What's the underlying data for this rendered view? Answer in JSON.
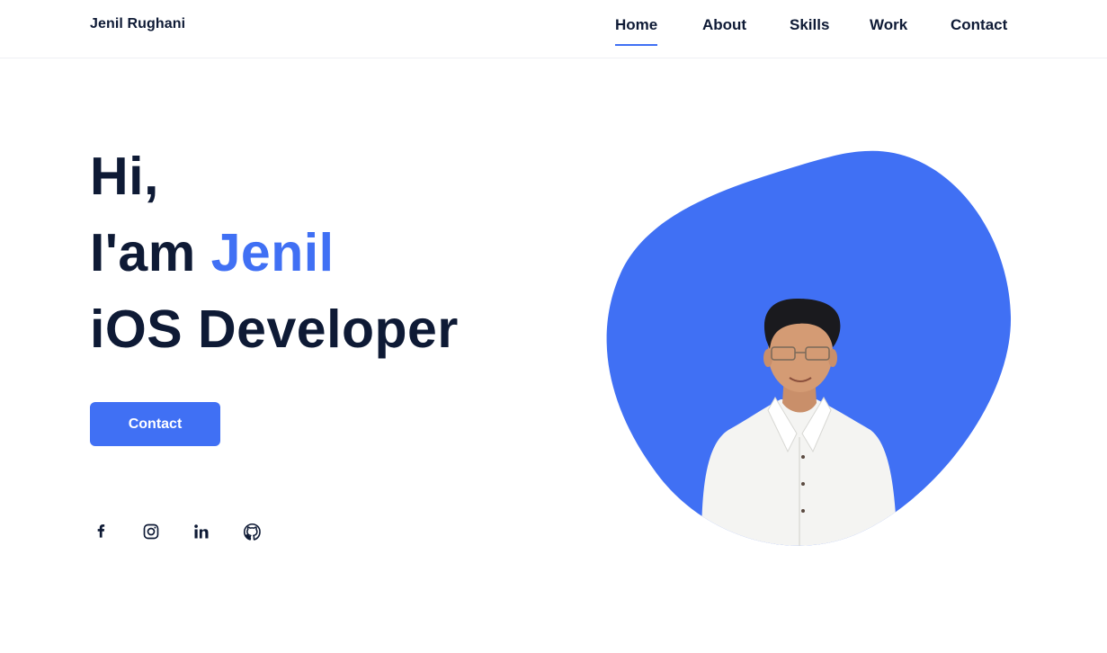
{
  "header": {
    "logo": "Jenil Rughani",
    "nav": [
      {
        "label": "Home",
        "active": true
      },
      {
        "label": "About",
        "active": false
      },
      {
        "label": "Skills",
        "active": false
      },
      {
        "label": "Work",
        "active": false
      },
      {
        "label": "Contact",
        "active": false
      }
    ]
  },
  "hero": {
    "greeting": "Hi,",
    "intro_prefix": "I'am ",
    "name": "Jenil",
    "role": "iOS Developer",
    "cta_label": "Contact"
  },
  "social": [
    {
      "icon": "facebook-icon"
    },
    {
      "icon": "instagram-icon"
    },
    {
      "icon": "linkedin-icon"
    },
    {
      "icon": "github-icon"
    }
  ],
  "colors": {
    "accent": "#4070f4",
    "text": "#0e1a35",
    "background": "#ffffff"
  }
}
